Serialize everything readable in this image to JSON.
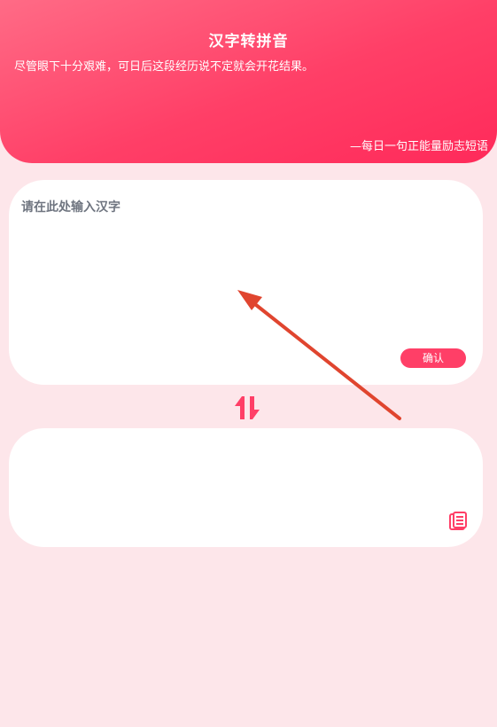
{
  "header": {
    "title": "汉字转拼音",
    "quote": "尽管眼下十分艰难，可日后这段经历说不定就会开花结果。",
    "source": "—每日一句正能量励志短语"
  },
  "input": {
    "placeholder": "请在此处输入汉字",
    "value": "",
    "confirm_label": "确认"
  },
  "output": {
    "value": ""
  },
  "icons": {
    "swap": "swap-arrows-icon",
    "copy": "copy-icon"
  },
  "colors": {
    "accent": "#ff3f67",
    "background": "#fde6ea",
    "annotation_arrow": "#e0452f"
  }
}
